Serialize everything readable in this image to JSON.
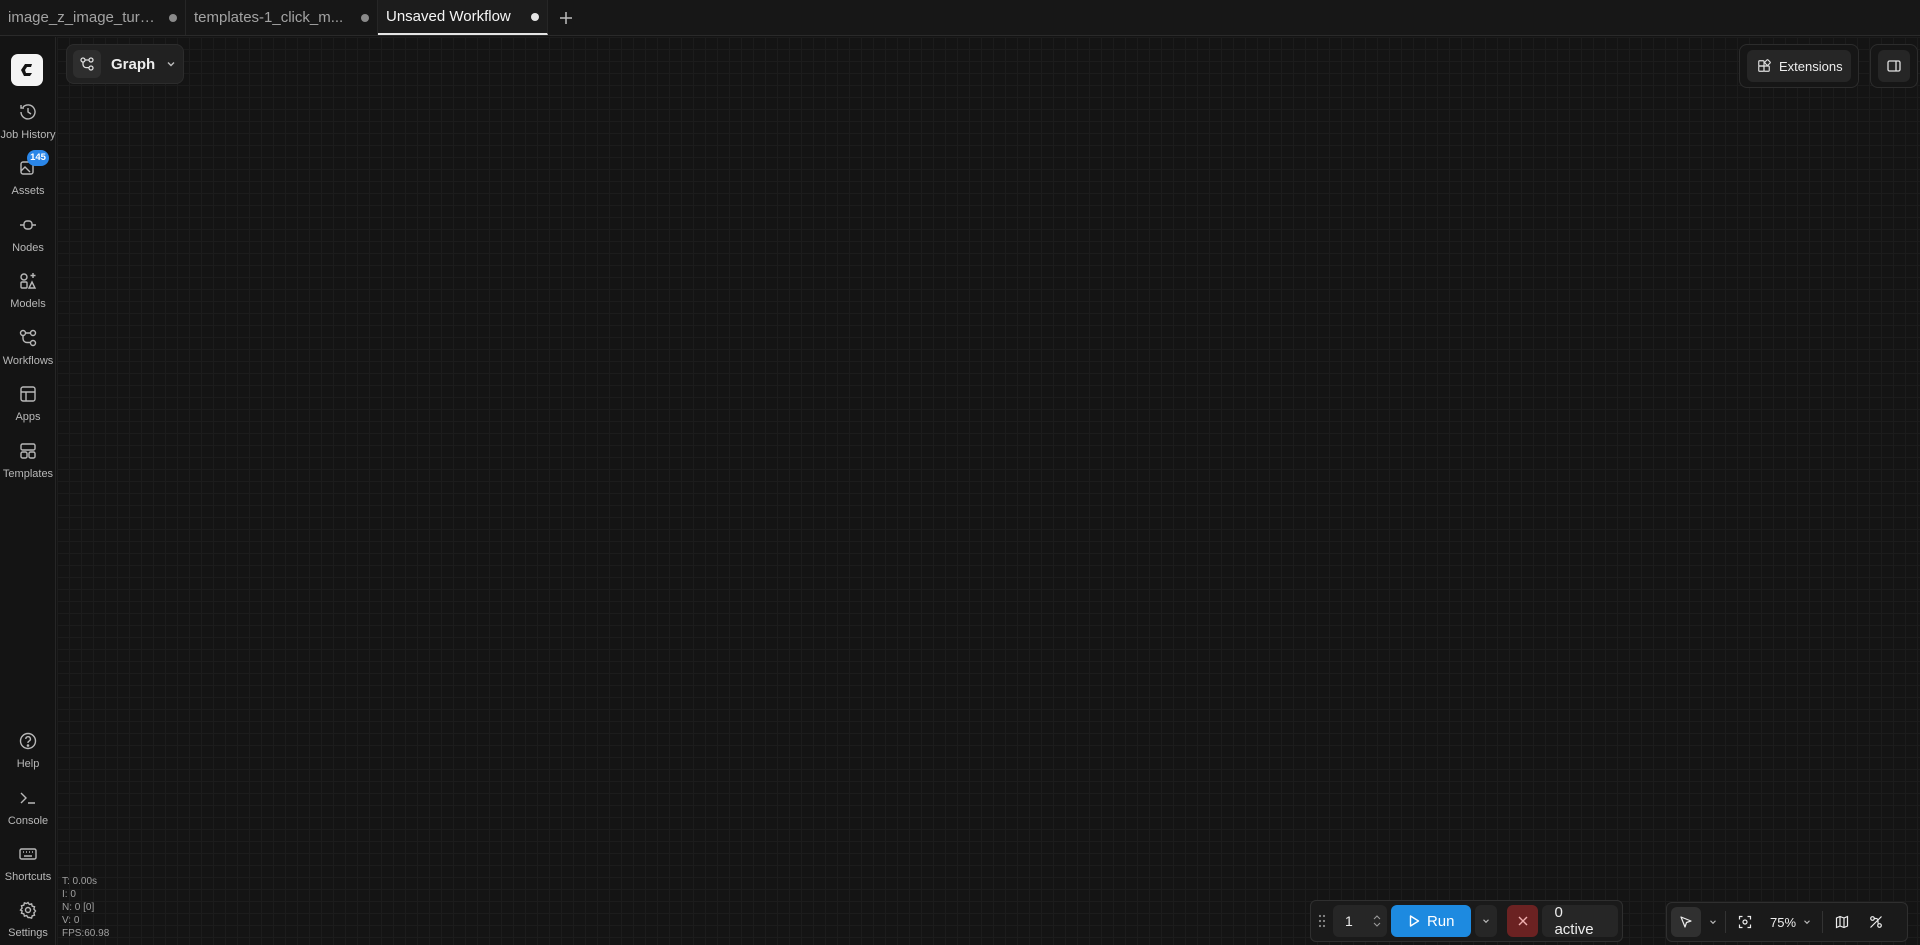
{
  "tabs": [
    {
      "label": "image_z_image_turbo",
      "active": false,
      "modified": true
    },
    {
      "label": "templates-1_click_m...",
      "active": false,
      "modified": true
    },
    {
      "label": "Unsaved Workflow",
      "active": true,
      "modified": true
    }
  ],
  "sidebar": {
    "items": [
      {
        "label": "Job History",
        "icon": "history-icon"
      },
      {
        "label": "Assets",
        "icon": "assets-icon",
        "badge": "145"
      },
      {
        "label": "Nodes",
        "icon": "nodes-icon"
      },
      {
        "label": "Models",
        "icon": "models-icon"
      },
      {
        "label": "Workflows",
        "icon": "workflows-icon"
      },
      {
        "label": "Apps",
        "icon": "apps-icon"
      },
      {
        "label": "Templates",
        "icon": "templates-icon"
      }
    ],
    "bottom_items": [
      {
        "label": "Help",
        "icon": "help-icon"
      },
      {
        "label": "Console",
        "icon": "console-icon"
      },
      {
        "label": "Shortcuts",
        "icon": "keyboard-icon"
      },
      {
        "label": "Settings",
        "icon": "gear-icon"
      }
    ]
  },
  "graph_menu": {
    "label": "Graph"
  },
  "extensions": {
    "label": "Extensions"
  },
  "stats": {
    "t": "T: 0.00s",
    "i": "I: 0",
    "n": "N: 0 [0]",
    "v": "V: 0",
    "fps": "FPS:60.98"
  },
  "run_toolbar": {
    "batch_count": "1",
    "run_label": "Run",
    "queue_label": "0 active"
  },
  "canvas_controls": {
    "zoom": "75%"
  },
  "colors": {
    "background": "#141414",
    "accent": "#1d8ae0",
    "cancel": "#6b2222",
    "badge": "#2a86e8"
  }
}
